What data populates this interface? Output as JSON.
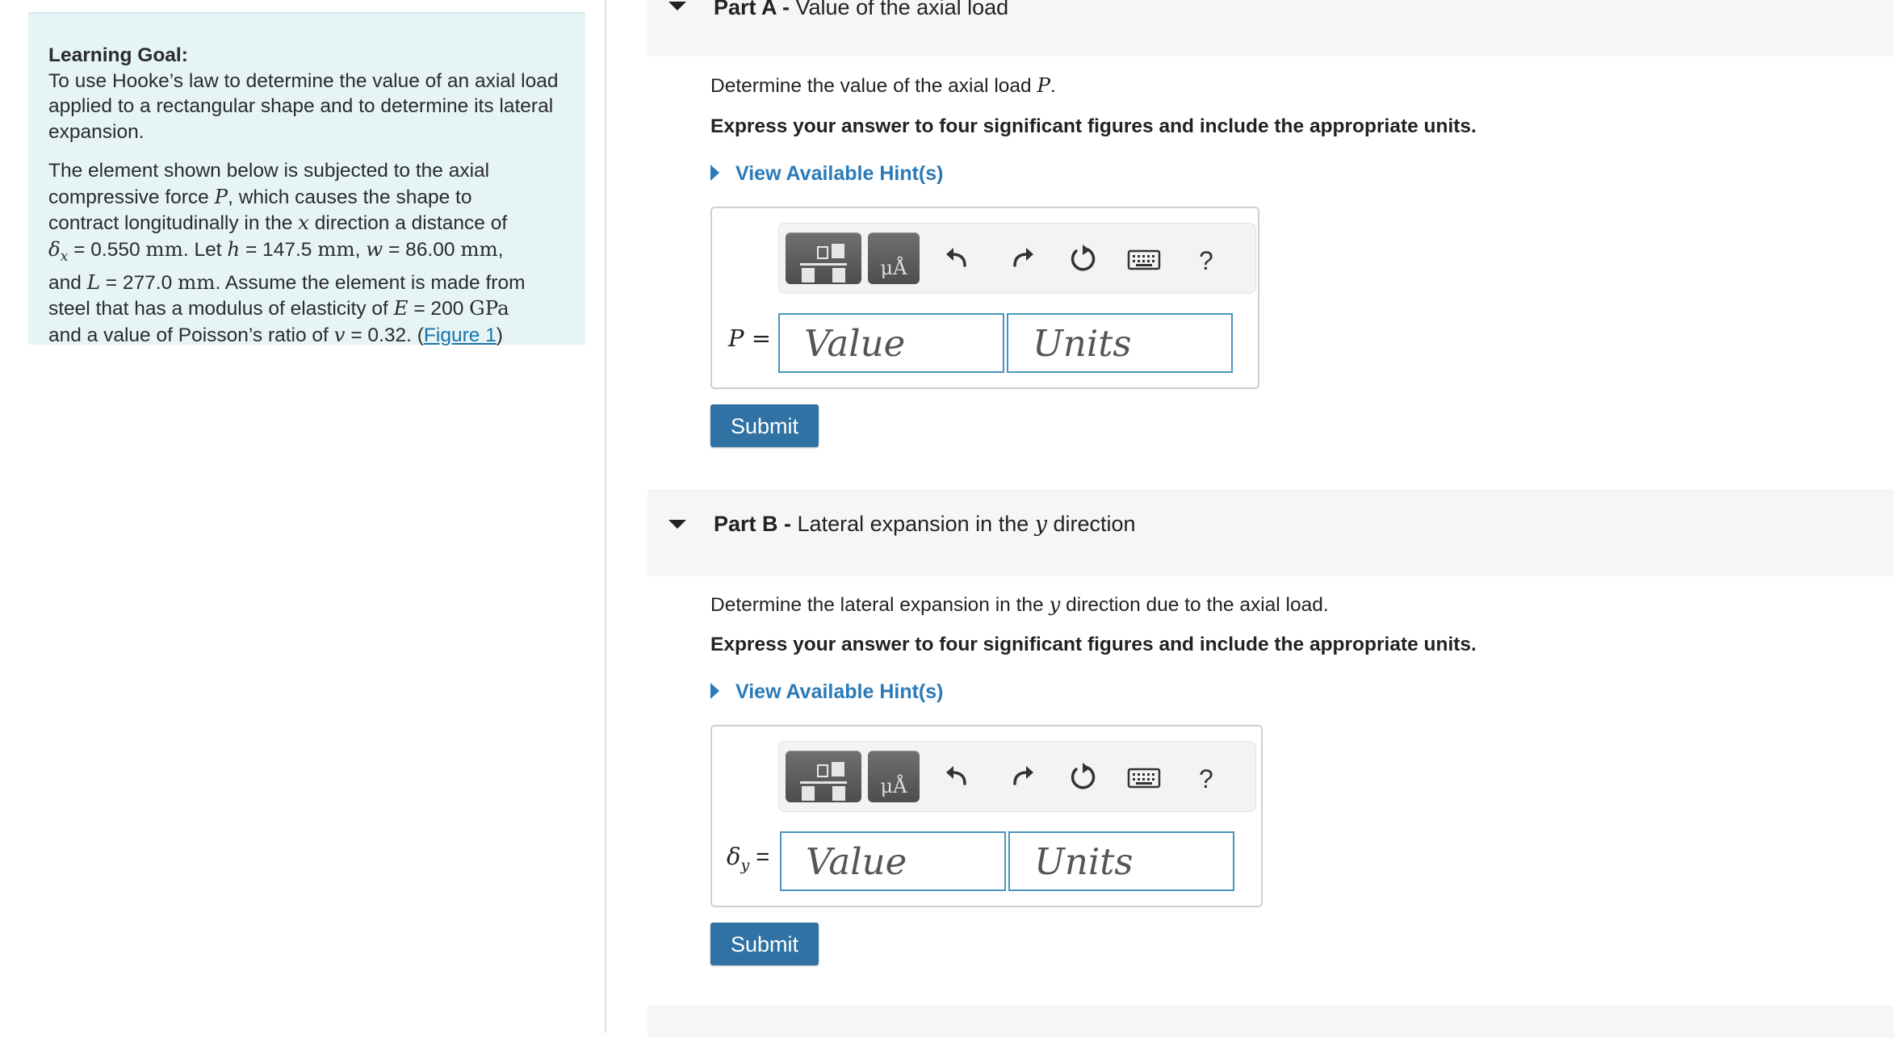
{
  "learning_goal": {
    "heading": "Learning Goal:",
    "intro": "To use Hooke’s law to determine the value of an axial load applied to a rectangular shape and to determine its lateral expansion.",
    "p_line1": "The element shown below is subjected to the axial",
    "p_line2a": "compressive force ",
    "p_line2_var": "P",
    "p_line2b": ", which causes the shape to",
    "p_line3a": "contract longitudinally in the ",
    "p_line3_var": "x",
    "p_line3b": " direction a distance of",
    "delta_x_var": "δ",
    "delta_x_sub": "x",
    "delta_x_eq": " = 0.550 ",
    "mm": "mm",
    "let_text": ". Let ",
    "h_var": "h",
    "h_eq": " = 147.5 ",
    "w_var": "w",
    "w_eq": " = 86.00 ",
    "and_text": "and ",
    "L_var": "L",
    "L_eq": " = 277.0 ",
    "assume_text": ". Assume the element is made from",
    "steel_text": "steel that has a modulus of elasticity of ",
    "E_var": "E",
    "E_eq": " = 200 ",
    "gpa": "GPa",
    "poisson_text": "and a value of Poisson’s ratio of ",
    "v_var": "v",
    "v_eq": " = 0.32. (",
    "figure_link": "Figure 1",
    "close_paren": ")"
  },
  "part_a": {
    "label": "Part A -",
    "title": " Value of the axial load",
    "question_prefix": "Determine the value of the axial load ",
    "question_var": "P",
    "question_suffix": ".",
    "instruction": "Express your answer to four significant figures and include the appropriate units.",
    "hint": "View Available Hint(s)",
    "units_button": "μÅ",
    "help": "?",
    "eq_label": "P =",
    "value_placeholder": "Value",
    "units_placeholder": "Units",
    "submit": "Submit"
  },
  "part_b": {
    "label": "Part B -",
    "title_prefix": " Lateral expansion in the ",
    "title_var": "y",
    "title_suffix": " direction",
    "question_prefix": "Determine the lateral expansion in the ",
    "question_var": "y",
    "question_suffix": " direction due to the axial load.",
    "instruction": "Express your answer to four significant figures and include the appropriate units.",
    "hint": "View Available Hint(s)",
    "units_button": "μÅ",
    "help": "?",
    "eq_label_var": "δ",
    "eq_label_sub": "y",
    "eq_label_suffix": " =",
    "value_placeholder": "Value",
    "units_placeholder": "Units",
    "submit": "Submit"
  },
  "colors": {
    "goal_background": "#e6f4f6",
    "link": "#2b7ab8",
    "submit": "#2f72a3",
    "field_border": "#4a95c0"
  },
  "icons": [
    "templates-icon",
    "units-icon",
    "undo-icon",
    "redo-icon",
    "reset-icon",
    "keyboard-icon",
    "help-icon",
    "caret-down-icon",
    "caret-right-icon"
  ]
}
